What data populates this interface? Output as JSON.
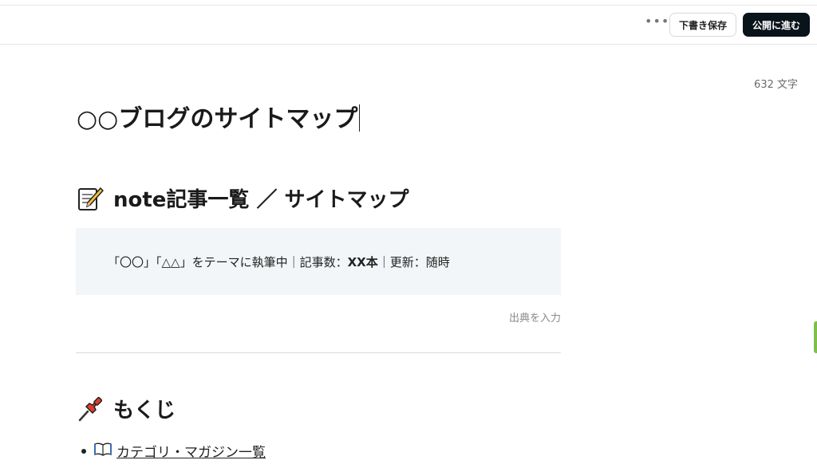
{
  "toolbar": {
    "more_label": "•••",
    "draft_label": "下書き保存",
    "publish_label": "公開に進む"
  },
  "editor": {
    "char_count": "632 文字",
    "title": "○○ブログのサイトマップ",
    "heading1": {
      "icon": "memo-icon",
      "text": "note記事一覧 ／ サイトマップ"
    },
    "quote": {
      "prefix": "「〇〇」「△△」をテーマに執筆中｜記事数：",
      "count": "XX本",
      "suffix": "｜更新：随時"
    },
    "citation_placeholder": "出典を入力",
    "heading2": {
      "icon": "pushpin-icon",
      "text": "もくじ"
    },
    "toc": [
      {
        "icon": "open-book-icon",
        "label": "カテゴリ・マガジン一覧"
      }
    ]
  },
  "colors": {
    "publish_bg": "#08131a",
    "quote_bg": "#f3f6f8",
    "side_tab": "#7cc04a"
  }
}
